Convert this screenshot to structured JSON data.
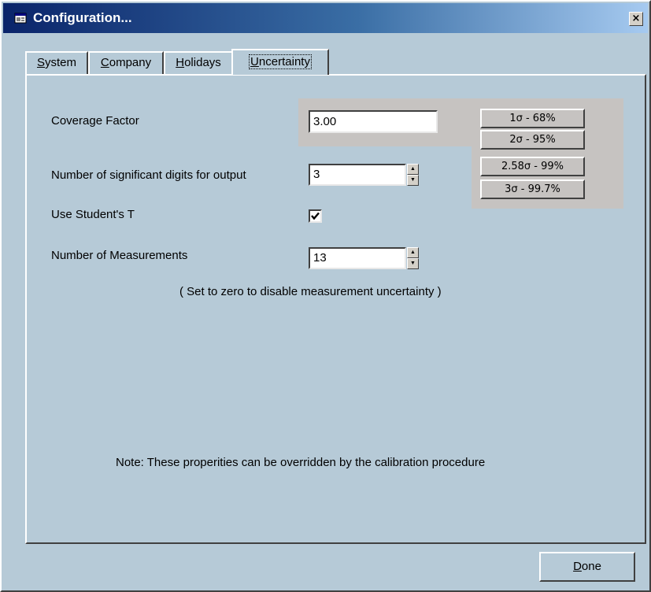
{
  "window": {
    "title": "Configuration...",
    "close_label": "×"
  },
  "tabs": [
    {
      "label": "System",
      "hotkey_index": 0,
      "active": false
    },
    {
      "label": "Company",
      "hotkey_index": 0,
      "active": false
    },
    {
      "label": "Holidays",
      "hotkey_index": 0,
      "active": false
    },
    {
      "label": "Uncertainty",
      "hotkey_index": 0,
      "active": true
    }
  ],
  "uncertainty": {
    "coverage_factor_label": "Coverage Factor",
    "coverage_factor_value": "3.00",
    "presets": [
      "1σ - 68%",
      "2σ - 95%",
      "2.58σ - 99%",
      "3σ - 99.7%"
    ],
    "sig_digits_label": "Number of significant digits for output",
    "sig_digits_value": "3",
    "students_t_label": "Use Student's T",
    "students_t_checked": true,
    "measurements_label": "Number of Measurements",
    "measurements_value": "13",
    "measurements_hint": "( Set to zero to disable measurement uncertainty )",
    "note": "Note: These properities can be overridden by the calibration procedure"
  },
  "footer": {
    "done_label": "Done"
  },
  "colors": {
    "face": "#b6cad7",
    "title_start": "#0a246a",
    "title_end": "#a6caf0",
    "preset_area": "#c6c3c1"
  },
  "icons": {
    "title": "window-app-icon",
    "check": "checkmark-icon",
    "spin_up": "up-arrow-icon",
    "spin_down": "down-arrow-icon"
  }
}
